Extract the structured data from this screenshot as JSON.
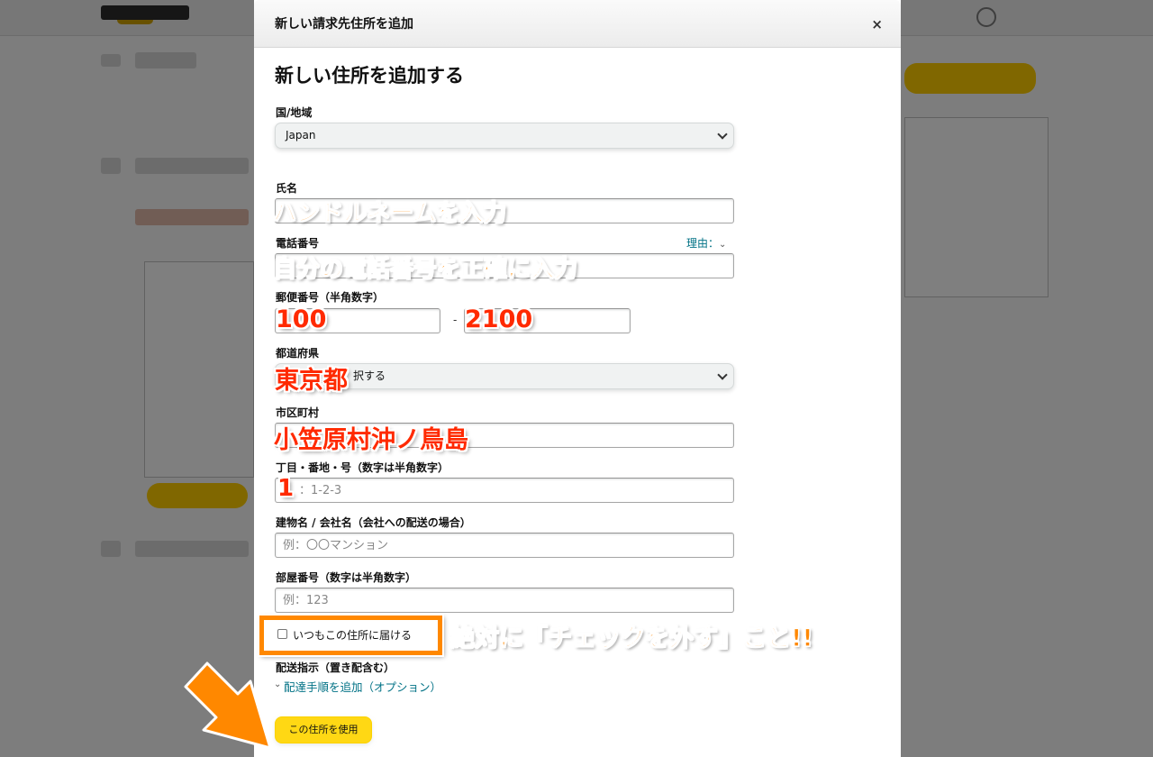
{
  "modal": {
    "header_title": "新しい請求先住所を追加",
    "close_label": "×",
    "form_title": "新しい住所を追加する"
  },
  "fields": {
    "country": {
      "label": "国/地域",
      "value": "Japan"
    },
    "name": {
      "label": "氏名",
      "value": ""
    },
    "phone": {
      "label": "電話番号",
      "reason_link": "理由：",
      "value": ""
    },
    "postal": {
      "label": "郵便番号（半角数字）",
      "part1": "",
      "part2": "",
      "separator": "-"
    },
    "prefecture": {
      "label": "都道府県",
      "value_visible": "択する"
    },
    "city": {
      "label": "市区町村",
      "value": ""
    },
    "street": {
      "label": "丁目・番地・号（数字は半角数字）",
      "placeholder": "：1-2-3"
    },
    "building": {
      "label": "建物名 / 会社名（会社への配送の場合）",
      "placeholder": "例：〇〇マンション"
    },
    "room": {
      "label": "部屋番号（数字は半角数字）",
      "placeholder": "例：123"
    },
    "default_checkbox": {
      "label": "いつもこの住所に届ける",
      "checked": false
    },
    "delivery": {
      "label": "配送指示（置き配含む）",
      "link": "配達手順を追加（オプション）"
    },
    "submit_label": "この住所を使用"
  },
  "annotations": {
    "name_note": "ハンドルネームを入力",
    "phone_note": "自分の電話番号を正確に入力",
    "postal_note_1": "100",
    "postal_note_2": "2100",
    "prefecture_note": "東京都",
    "city_note": "小笠原村沖ノ鳥島",
    "street_note": "1",
    "checkbox_note": "絶対に「チェックを外す」こと!!"
  },
  "colors": {
    "annotation_orange": "#ff8800",
    "annotation_red": "#ff2a00",
    "link_teal": "#007185",
    "button_yellow": "#ffd814"
  }
}
